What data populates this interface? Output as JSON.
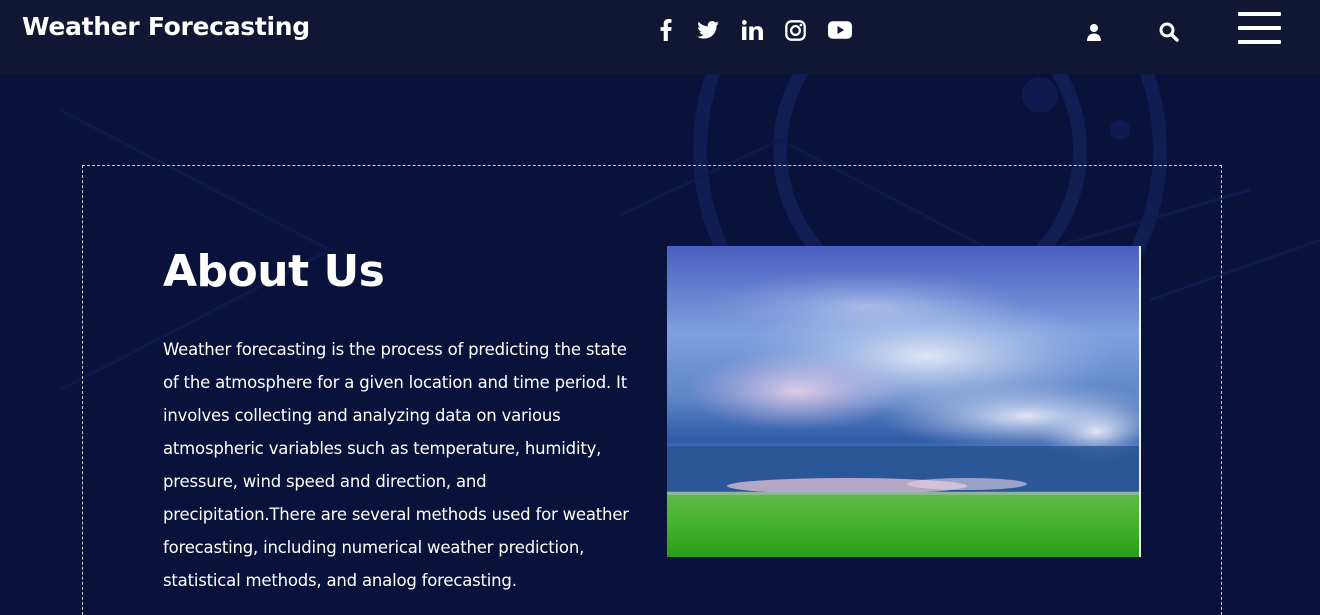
{
  "header": {
    "brand": "Weather Forecasting",
    "socials": [
      "facebook-icon",
      "twitter-icon",
      "linkedin-icon",
      "instagram-icon",
      "youtube-icon"
    ],
    "actions": [
      "user-icon",
      "search-icon",
      "menu-icon"
    ]
  },
  "about": {
    "title": "About Us",
    "body": "Weather forecasting is the process of predicting the state of the atmosphere for a given location and time period. It involves collecting and analyzing data on various atmospheric variables such as temperature, humidity, pressure, wind speed and direction, and precipitation.There are several methods used for weather forecasting, including numerical weather prediction, statistical methods, and analog forecasting."
  },
  "colors": {
    "background": "#08123a",
    "header": "#111633",
    "text": "#ffffff"
  }
}
